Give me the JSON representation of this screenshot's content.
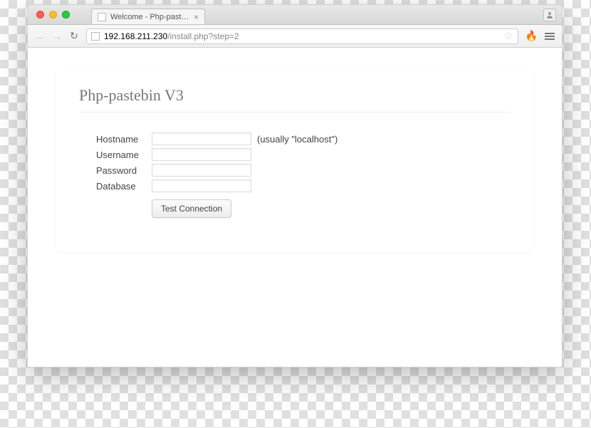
{
  "browser": {
    "tab_title": "Welcome - Php-pastebin V",
    "url_host": "192.168.211.230",
    "url_path": "/install.php?step=2"
  },
  "page": {
    "title": "Php-pastebin V3",
    "fields": {
      "hostname": {
        "label": "Hostname",
        "value": "",
        "hint": "(usually \"localhost\")"
      },
      "username": {
        "label": "Username",
        "value": ""
      },
      "password": {
        "label": "Password",
        "value": ""
      },
      "database": {
        "label": "Database",
        "value": ""
      }
    },
    "button": "Test Connection"
  }
}
